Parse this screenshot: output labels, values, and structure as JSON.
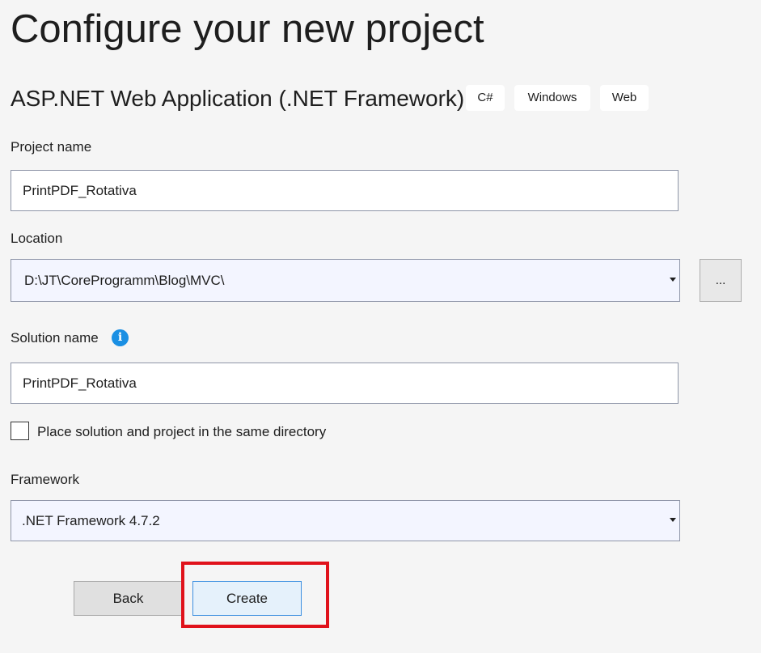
{
  "header": {
    "title": "Configure your new project",
    "template_name": "ASP.NET Web Application (.NET Framework)",
    "tags": [
      "C#",
      "Windows",
      "Web"
    ]
  },
  "project_name": {
    "label": "Project name",
    "value": "PrintPDF_Rotativa"
  },
  "location": {
    "label": "Location",
    "value": "D:\\JT\\CoreProgramm\\Blog\\MVC\\",
    "browse_label": "..."
  },
  "solution_name": {
    "label": "Solution name",
    "value": "PrintPDF_Rotativa",
    "info_icon": "info-icon"
  },
  "same_directory": {
    "label": "Place solution and project in the same directory",
    "checked": false
  },
  "framework": {
    "label": "Framework",
    "value": ".NET Framework 4.7.2"
  },
  "footer": {
    "back_label": "Back",
    "create_label": "Create"
  },
  "colors": {
    "background": "#f5f5f5",
    "highlight_border": "#e0121b",
    "create_border": "#3c8fe0",
    "info_icon": "#1a8fe3"
  }
}
